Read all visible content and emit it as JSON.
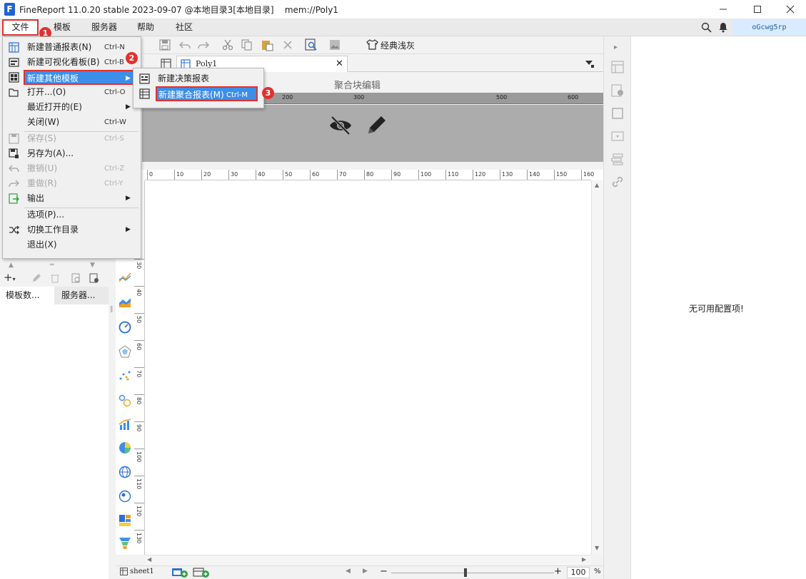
{
  "window": {
    "title": "FineReport 11.0.20 stable 2023-09-07 @本地目录3[本地目录]    mem://Poly1",
    "logo_letter": "F"
  },
  "menubar": {
    "items": [
      "文件",
      "模板",
      "服务器",
      "帮助",
      "社区"
    ],
    "user": "oGcwg5rp"
  },
  "toolbar": {
    "style_label": "经典浅灰"
  },
  "tab": {
    "name": "Poly1"
  },
  "block_editor": {
    "title": "聚合块编辑",
    "ruler_ticks": [
      "200",
      "300",
      "500",
      "600"
    ]
  },
  "file_menu": {
    "items": [
      {
        "label": "新建普通报表(N)",
        "shortcut": "Ctrl-N"
      },
      {
        "label": "新建可视化看板(B)",
        "shortcut": "Ctrl-B"
      },
      {
        "label": "新建其他模板",
        "shortcut": ""
      },
      {
        "label": "打开...(O)",
        "shortcut": "Ctrl-O"
      },
      {
        "label": "最近打开的(E)",
        "shortcut": ""
      },
      {
        "label": "关闭(W)",
        "shortcut": "Ctrl-W"
      },
      {
        "label": "保存(S)",
        "shortcut": "Ctrl-S"
      },
      {
        "label": "另存为(A)...",
        "shortcut": ""
      },
      {
        "label": "撤销(U)",
        "shortcut": "Ctrl-Z"
      },
      {
        "label": "重做(R)",
        "shortcut": "Ctrl-Y"
      },
      {
        "label": "输出",
        "shortcut": ""
      },
      {
        "label": "选项(P)...",
        "shortcut": ""
      },
      {
        "label": "切换工作目录",
        "shortcut": ""
      },
      {
        "label": "退出(X)",
        "shortcut": ""
      }
    ]
  },
  "submenu": {
    "items": [
      {
        "label": "新建决策报表",
        "shortcut": ""
      },
      {
        "label": "新建聚合报表(M)",
        "shortcut": "Ctrl-M"
      }
    ]
  },
  "badges": [
    "1",
    "2",
    "3"
  ],
  "left_panel": {
    "tabs": [
      "模板数...",
      "服务器..."
    ]
  },
  "ruler_h": [
    "0",
    "10",
    "20",
    "30",
    "40",
    "50",
    "60",
    "70",
    "80",
    "90",
    "100",
    "110",
    "120",
    "130",
    "140",
    "150",
    "160"
  ],
  "ruler_v": [
    "30",
    "40",
    "50",
    "60",
    "70",
    "80",
    "90",
    "100",
    "110",
    "120",
    "130"
  ],
  "config_panel": {
    "empty_text": "无可用配置项!"
  },
  "statusbar": {
    "sheet": "sheet1",
    "zoom": "100",
    "zoom_unit": "%"
  },
  "colors": {
    "accent": "#3d8ee8",
    "annotation_red": "#e03131",
    "brand": "#1f62d4"
  }
}
